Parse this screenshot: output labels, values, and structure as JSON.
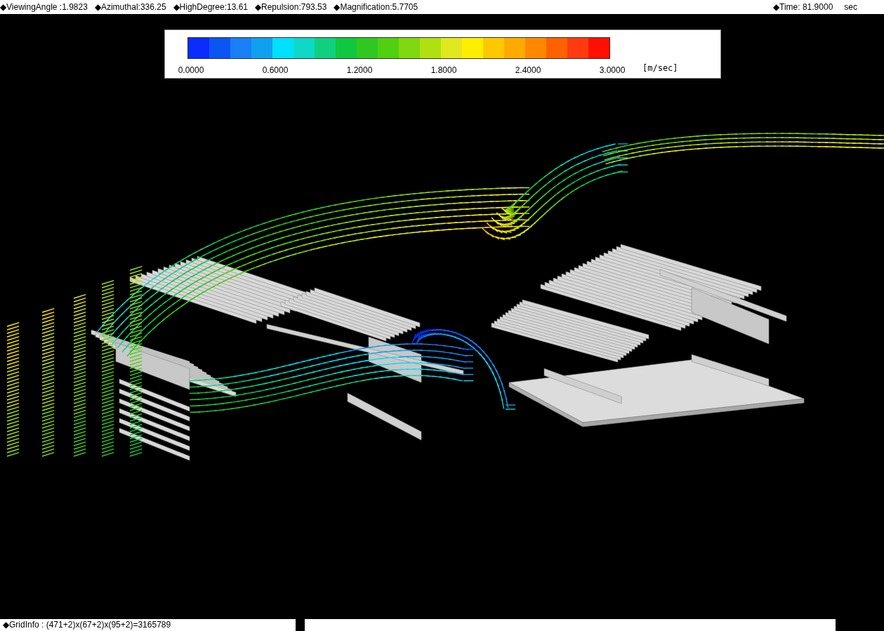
{
  "status_bar": {
    "items": [
      {
        "text": "◆ViewingAngle :1.9823"
      },
      {
        "text": "◆Azimuthal:336.25"
      },
      {
        "text": "◆HighDegree:13.61"
      },
      {
        "text": "◆Repulsion:793.53"
      },
      {
        "text": "◆Magnification:5.7705"
      }
    ],
    "time": "◆Time: 81.9000",
    "time_unit": "sec"
  },
  "legend": {
    "swatches": [
      {
        "color": "#0a2cff"
      },
      {
        "color": "#0b55f0"
      },
      {
        "color": "#1a80f5"
      },
      {
        "color": "#10a0f0"
      },
      {
        "color": "#00e0ff"
      },
      {
        "color": "#10d8c8"
      },
      {
        "color": "#10d080"
      },
      {
        "color": "#10c840"
      },
      {
        "color": "#30c820"
      },
      {
        "color": "#50d010"
      },
      {
        "color": "#80d810"
      },
      {
        "color": "#b0e010"
      },
      {
        "color": "#e0e820"
      },
      {
        "color": "#ffee00"
      },
      {
        "color": "#ffc800"
      },
      {
        "color": "#ffaa00"
      },
      {
        "color": "#ff8800"
      },
      {
        "color": "#ff6000"
      },
      {
        "color": "#ff3a10"
      },
      {
        "color": "#ff1000"
      }
    ],
    "ticks": [
      "0.0000",
      "0.6000",
      "1.2000",
      "1.8000",
      "2.4000",
      "3.0000"
    ],
    "unit": "[m/sec]"
  },
  "bottom_bar": {
    "grid_info": "◆GridInfo : (471+2)x(67+2)x(95+2)=3165789"
  }
}
